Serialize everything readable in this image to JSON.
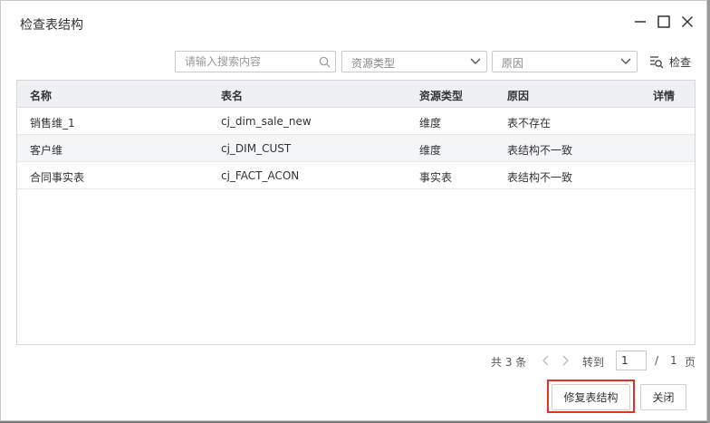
{
  "dialog": {
    "title": "检查表结构"
  },
  "toolbar": {
    "search_placeholder": "请输入搜索内容",
    "type_select": "资源类型",
    "reason_select": "原因",
    "check_label": "检查"
  },
  "table": {
    "headers": [
      "名称",
      "表名",
      "资源类型",
      "原因",
      "详情"
    ],
    "rows": [
      [
        "销售维_1",
        "cj_dim_sale_new",
        "维度",
        "表不存在",
        ""
      ],
      [
        "客户维",
        "cj_DIM_CUST",
        "维度",
        "表结构不一致",
        ""
      ],
      [
        "合同事实表",
        "cj_FACT_ACON",
        "事实表",
        "表结构不一致",
        ""
      ]
    ]
  },
  "pager": {
    "total": "共 3 条",
    "goto": "转到",
    "current_page": "1",
    "slash": "/",
    "pages": "1",
    "page_unit": "页"
  },
  "buttons": {
    "repair": "修复表结构",
    "close": "关闭"
  },
  "colors": {
    "highlight": "#e0312a",
    "header_bg": "#eef0f3"
  }
}
